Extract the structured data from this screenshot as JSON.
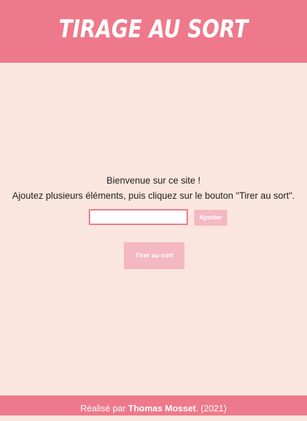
{
  "header": {
    "title": "Tirage au sort"
  },
  "main": {
    "welcome_line1": "Bienvenue sur ce site !",
    "welcome_line2": "Ajoutez plusieurs éléments, puis cliquez sur le bouton \"Tirer au sort\".",
    "input": {
      "value": "",
      "placeholder": ""
    },
    "add_button_label": "Ajouter",
    "draw_button_label": "Tirer au sort"
  },
  "footer": {
    "prefix": "Réalisé par ",
    "author": "Thomas Mosset",
    "suffix": ". (2021)"
  },
  "colors": {
    "accent": "#ee798b",
    "background": "#fae6df",
    "button": "#f4b8c3"
  }
}
